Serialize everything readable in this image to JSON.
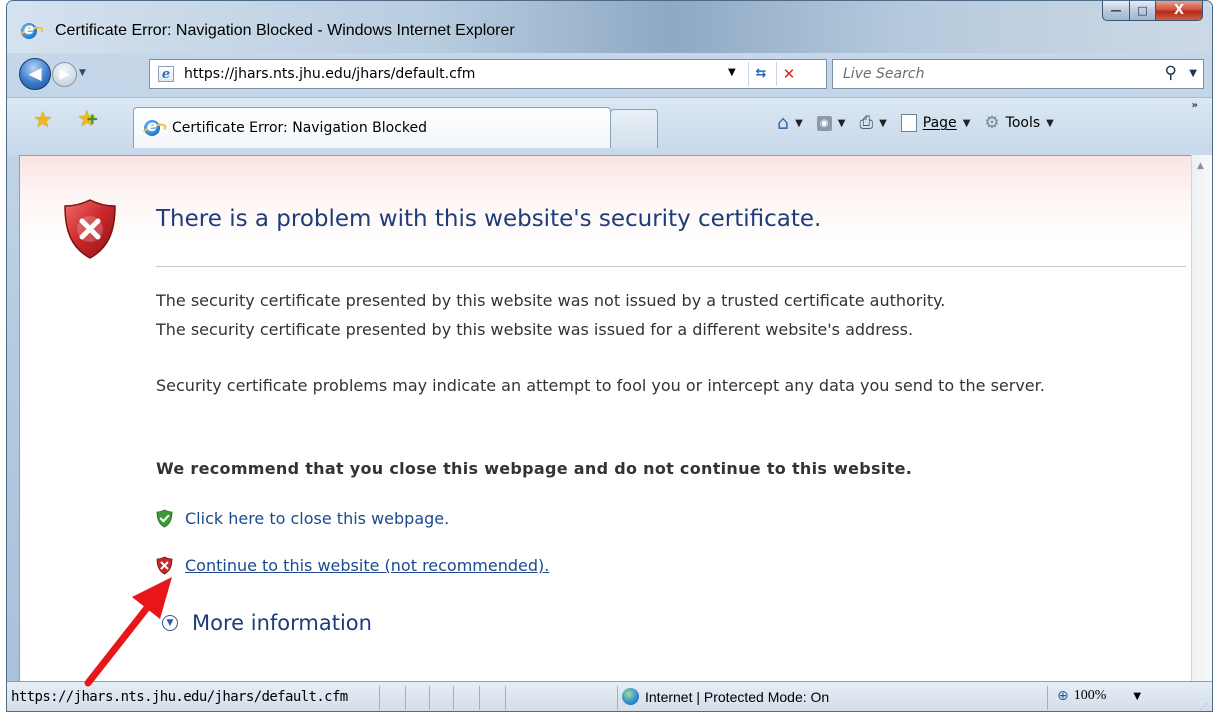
{
  "window": {
    "title": "Certificate Error: Navigation Blocked - Windows Internet Explorer",
    "minimize_glyph": "—",
    "maximize_glyph": "□",
    "close_glyph": "X"
  },
  "address_bar": {
    "url": "https://jhars.nts.jhu.edu/jhars/default.cfm",
    "search_placeholder": "Live Search"
  },
  "tabs": [
    {
      "label": "Certificate Error: Navigation Blocked",
      "active": true
    }
  ],
  "command_bar": {
    "page_label": "Page",
    "tools_label": "Tools"
  },
  "content": {
    "heading": "There is a problem with this website's security certificate.",
    "paragraph1_line1": "The security certificate presented by this website was not issued by a trusted certificate authority.",
    "paragraph1_line2": "The security certificate presented by this website was issued for a different website's address.",
    "paragraph2": "Security certificate problems may indicate an attempt to fool you or intercept any data you send to the server.",
    "recommendation": "We recommend that you close this webpage and do not continue to this website.",
    "close_link": "Click here to close this webpage.",
    "continue_link": "Continue to this website (not recommended).",
    "more_info": "More information"
  },
  "status_bar": {
    "url": "https://jhars.nts.jhu.edu/jhars/default.cfm",
    "zone": "Internet | Protected Mode: On",
    "zoom": "100%"
  },
  "icons": {
    "error_shield_color": "#c8262b",
    "safe_shield_color": "#3c9a3a",
    "annotation_arrow_color": "#e8161b"
  }
}
